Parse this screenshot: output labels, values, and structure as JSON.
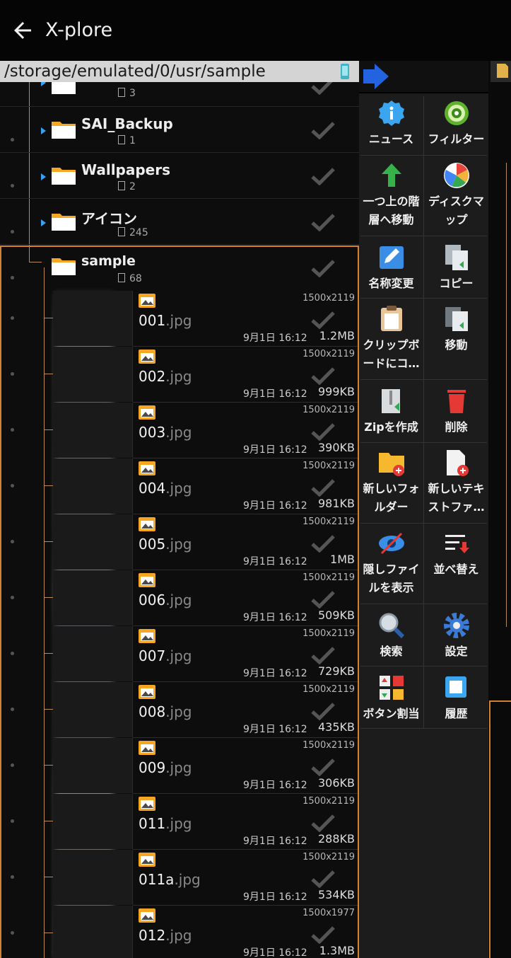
{
  "app": {
    "title": "X-plore"
  },
  "path": {
    "text": "/storage/emulated/0/usr/sample"
  },
  "folders": [
    {
      "name": "",
      "count": "3"
    },
    {
      "name": "SAI_Backup",
      "count": "1"
    },
    {
      "name": "Wallpapers",
      "count": "2"
    },
    {
      "name": "アイコン",
      "count": "245"
    },
    {
      "name": "sample",
      "count": "68"
    }
  ],
  "files": [
    {
      "base": "001",
      "ext": ".jpg",
      "res": "1500x2119",
      "date": "9月1日 16:12",
      "size": "1.2MB"
    },
    {
      "base": "002",
      "ext": ".jpg",
      "res": "1500x2119",
      "date": "9月1日 16:12",
      "size": "999KB"
    },
    {
      "base": "003",
      "ext": ".jpg",
      "res": "1500x2119",
      "date": "9月1日 16:12",
      "size": "390KB"
    },
    {
      "base": "004",
      "ext": ".jpg",
      "res": "1500x2119",
      "date": "9月1日 16:12",
      "size": "981KB"
    },
    {
      "base": "005",
      "ext": ".jpg",
      "res": "1500x2119",
      "date": "9月1日 16:12",
      "size": "1MB"
    },
    {
      "base": "006",
      "ext": ".jpg",
      "res": "1500x2119",
      "date": "9月1日 16:12",
      "size": "509KB"
    },
    {
      "base": "007",
      "ext": ".jpg",
      "res": "1500x2119",
      "date": "9月1日 16:12",
      "size": "729KB"
    },
    {
      "base": "008",
      "ext": ".jpg",
      "res": "1500x2119",
      "date": "9月1日 16:12",
      "size": "435KB"
    },
    {
      "base": "009",
      "ext": ".jpg",
      "res": "1500x2119",
      "date": "9月1日 16:12",
      "size": "306KB"
    },
    {
      "base": "011",
      "ext": ".jpg",
      "res": "1500x2119",
      "date": "9月1日 16:12",
      "size": "288KB"
    },
    {
      "base": "011a",
      "ext": ".jpg",
      "res": "1500x2119",
      "date": "9月1日 16:12",
      "size": "534KB"
    },
    {
      "base": "012",
      "ext": ".jpg",
      "res": "1500x1977",
      "date": "9月1日 16:12",
      "size": "1.3MB"
    }
  ],
  "menu": {
    "news": [
      "ニュース"
    ],
    "filter": [
      "フィルター"
    ],
    "up_level": [
      "一つ上の階",
      "層へ移動"
    ],
    "disk_map": [
      "ディスクマ",
      "ップ"
    ],
    "rename": [
      "名称変更"
    ],
    "copy": [
      "コピー"
    ],
    "clipboard": [
      "クリップボ",
      "ードにコ…"
    ],
    "move": [
      "移動"
    ],
    "zip": [
      "Zipを作成"
    ],
    "delete": [
      "削除"
    ],
    "new_folder": [
      "新しいフォ",
      "ルダー"
    ],
    "new_text": [
      "新しいテキ",
      "ストファ…"
    ],
    "show_hidden": [
      "隠しファイ",
      "ルを表示"
    ],
    "sort": [
      "並べ替え"
    ],
    "search": [
      "検索"
    ],
    "settings": [
      "設定"
    ],
    "button_assign": [
      "ボタン割当"
    ],
    "history": [
      "履歴"
    ]
  },
  "colors": {
    "accent": "#d4812d",
    "expander": "#3aa0f0",
    "folder": "#f5a623",
    "pathbar": "#d4d4d4"
  },
  "icons": {
    "back": "arrow-left-icon",
    "news": "info-badge-icon",
    "filter": "target-icon",
    "up_level": "up-arrow-icon",
    "disk_map": "pie-chart-icon",
    "rename": "pencil-icon",
    "copy": "copy-icon",
    "clipboard": "clipboard-icon",
    "move": "move-icon",
    "zip": "zip-icon",
    "delete": "trash-icon",
    "new_folder": "folder-plus-icon",
    "new_text": "file-plus-icon",
    "show_hidden": "eye-slash-icon",
    "sort": "sort-icon",
    "search": "search-icon",
    "settings": "gear-icon",
    "button_assign": "grid-icon",
    "history": "history-icon"
  }
}
